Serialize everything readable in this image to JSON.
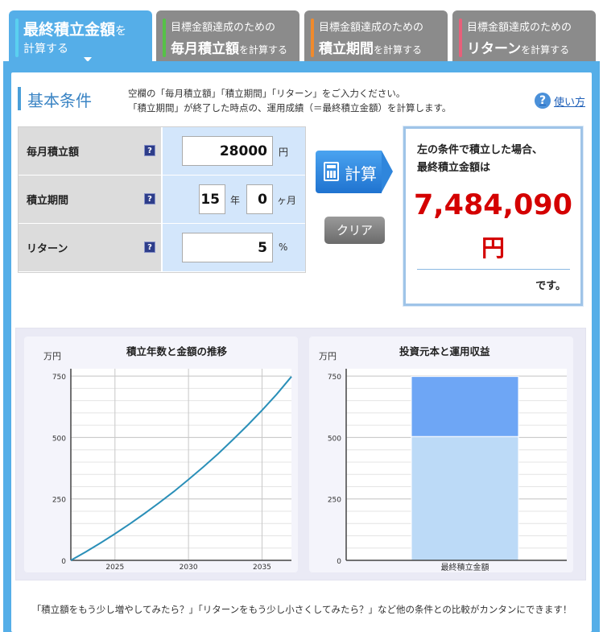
{
  "tabs": [
    {
      "line1": "最終積立金額",
      "line1_small": "を",
      "line2": "計算する",
      "active": true
    },
    {
      "line1": "目標金額達成のための",
      "line2": "毎月積立額",
      "line2_small": "を計算する",
      "accent": "#56c247"
    },
    {
      "line1": "目標金額達成のための",
      "line2": "積立期間",
      "line2_small": "を計算する",
      "accent": "#f08a2c"
    },
    {
      "line1": "目標金額達成のための",
      "line2": "リターン",
      "line2_small": "を計算する",
      "accent": "#e8607a"
    }
  ],
  "section": {
    "title": "基本条件",
    "desc1": "空欄の「毎月積立額」「積立期間」「リターン」をご入力ください。",
    "desc2": "「積立期間」が終了した時点の、運用成績（＝最終積立金額）を計算します。",
    "help_label": "使い方"
  },
  "form": {
    "monthly": {
      "label": "毎月積立額",
      "value": "28000",
      "unit": "円"
    },
    "period": {
      "label": "積立期間",
      "years": "15",
      "year_unit": "年",
      "months": "0",
      "month_unit": "ヶ月"
    },
    "return": {
      "label": "リターン",
      "value": "5",
      "unit": "%"
    },
    "help_glyph": "?"
  },
  "buttons": {
    "calc": "計算",
    "clear": "クリア"
  },
  "result": {
    "line1": "左の条件で積立した場合、",
    "line2": "最終積立金額は",
    "amount": "7,484,090",
    "yen": "円",
    "suffix": "です。"
  },
  "chart_data": [
    {
      "type": "line",
      "title": "積立年数と金額の推移",
      "ylabel": "万円",
      "x": [
        2022,
        2023,
        2024,
        2025,
        2026,
        2027,
        2028,
        2029,
        2030,
        2031,
        2032,
        2033,
        2034,
        2035,
        2036,
        2037
      ],
      "series": [
        {
          "values": [
            0,
            34,
            70,
            108,
            148,
            190,
            234,
            280,
            329,
            380,
            433,
            490,
            549,
            611,
            676,
            748
          ]
        }
      ],
      "xticks": [
        2025,
        2030,
        2035
      ],
      "yticks": [
        0,
        250,
        500,
        750
      ],
      "xlim": [
        2022,
        2037
      ],
      "ylim": [
        0,
        780
      ],
      "grid": true,
      "color": "#2a8fb8"
    },
    {
      "type": "bar",
      "title": "投資元本と運用収益",
      "ylabel": "万円",
      "categories": [
        "最終積立金額"
      ],
      "series": [
        {
          "values": [
            504
          ],
          "color": "#bcdaf7"
        },
        {
          "values": [
            244.4
          ],
          "color": "#6ea6f5"
        }
      ],
      "yticks": [
        0,
        250,
        500,
        750
      ],
      "ylim": [
        0,
        780
      ],
      "stacked": true,
      "grid": true
    }
  ],
  "footer": "「積立額をもう少し増やしてみたら？」「リターンをもう少し小さくしてみたら？」など他の条件との比較がカンタンにできます！"
}
